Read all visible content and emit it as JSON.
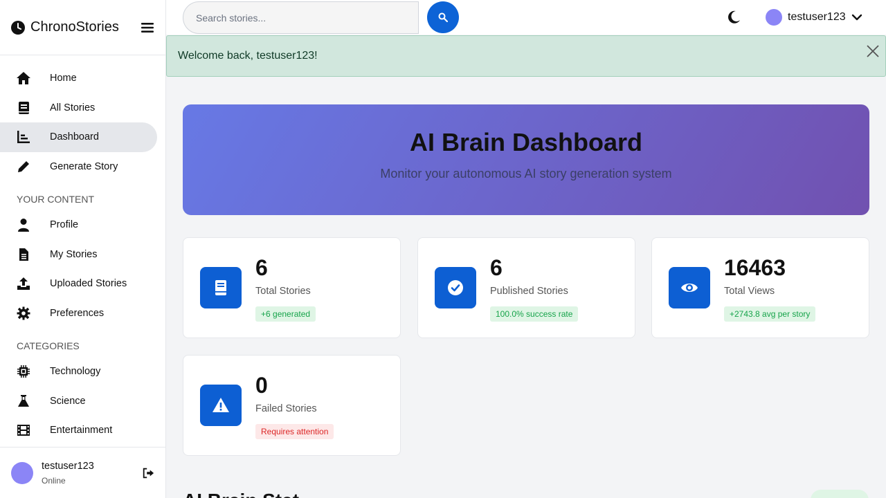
{
  "brand": {
    "name": "ChronoStories"
  },
  "nav": {
    "main": [
      {
        "label": "Home",
        "icon": "home-icon"
      },
      {
        "label": "All Stories",
        "icon": "book-icon"
      },
      {
        "label": "Dashboard",
        "icon": "chart-bar-icon"
      },
      {
        "label": "Generate Story",
        "icon": "pen-icon"
      }
    ],
    "your_content_title": "YOUR CONTENT",
    "your_content": [
      {
        "label": "Profile",
        "icon": "user-icon"
      },
      {
        "label": "My Stories",
        "icon": "file-icon"
      },
      {
        "label": "Uploaded Stories",
        "icon": "upload-icon"
      },
      {
        "label": "Preferences",
        "icon": "gear-icon"
      }
    ],
    "categories_title": "CATEGORIES",
    "categories": [
      {
        "label": "Technology",
        "icon": "chip-icon"
      },
      {
        "label": "Science",
        "icon": "flask-icon"
      },
      {
        "label": "Entertainment",
        "icon": "film-icon"
      }
    ]
  },
  "sidebar_footer": {
    "username": "testuser123",
    "status": "Online"
  },
  "topbar": {
    "search_placeholder": "Search stories...",
    "username": "testuser123"
  },
  "alert": {
    "message": "Welcome back, testuser123!"
  },
  "hero": {
    "title": "AI Brain Dashboard",
    "subtitle": "Monitor your autonomous AI story generation system"
  },
  "stats": [
    {
      "value": "6",
      "label": "Total Stories",
      "badge": "+6 generated",
      "badge_type": "ok",
      "icon": "book-icon"
    },
    {
      "value": "6",
      "label": "Published Stories",
      "badge": "100.0% success rate",
      "badge_type": "ok",
      "icon": "check-circle-icon"
    },
    {
      "value": "16463",
      "label": "Total Views",
      "badge": "+2743.8 avg per story",
      "badge_type": "ok",
      "icon": "eye-icon"
    },
    {
      "value": "0",
      "label": "Failed Stories",
      "badge": "Requires attention",
      "badge_type": "bad",
      "icon": "warning-icon"
    }
  ],
  "section_partial": "AI Brain Stat",
  "colors": {
    "primary": "#0d5fd3",
    "alert_bg": "#d1e7dd",
    "hero_start": "#6779e5",
    "hero_end": "#7151b0"
  }
}
